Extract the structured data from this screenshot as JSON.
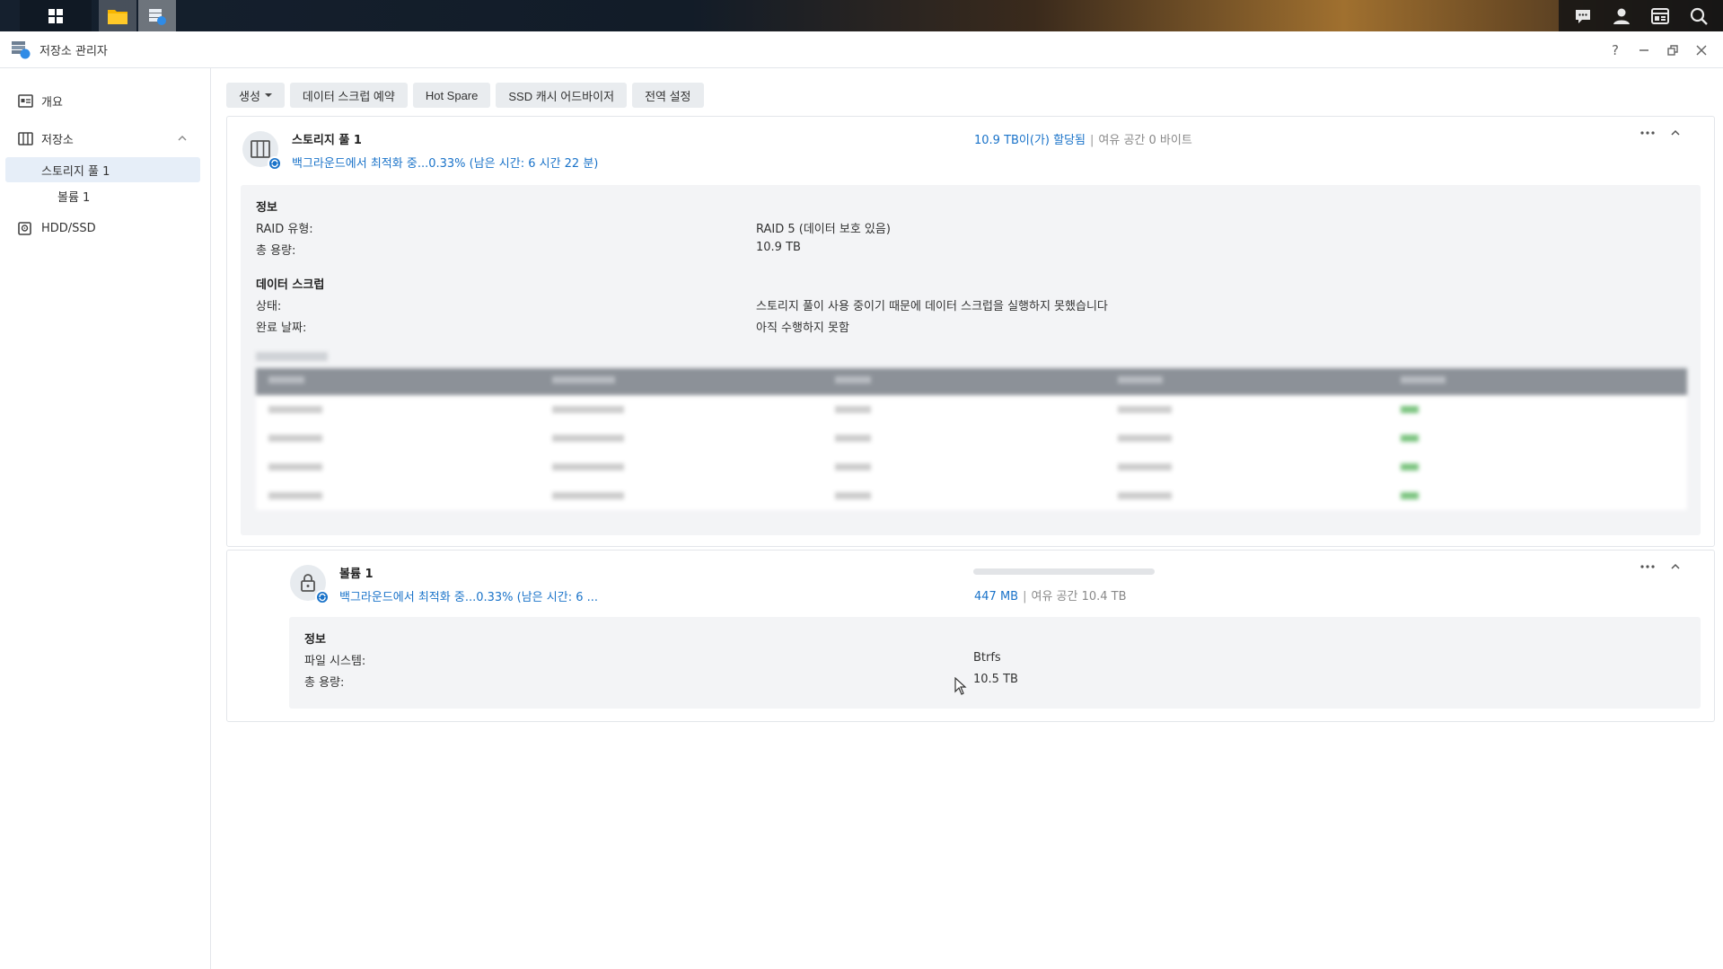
{
  "app": {
    "title": "저장소 관리자"
  },
  "window_controls": {
    "help": "?"
  },
  "sidebar": {
    "items": [
      {
        "label": "개요"
      },
      {
        "label": "저장소"
      },
      {
        "label": "HDD/SSD"
      }
    ],
    "sub_items": [
      {
        "label": "스토리지 풀 1"
      },
      {
        "label": "볼륨 1"
      }
    ]
  },
  "toolbar": {
    "create_label": "생성",
    "scrub_label": "데이터 스크럽 예약",
    "hotspare_label": "Hot Spare",
    "ssd_label": "SSD 캐시 어드바이저",
    "global_label": "전역 설정"
  },
  "pool": {
    "title": "스토리지 풀 1",
    "status": "백그라운드에서 최적화 중...0.33% (남은 시간: 6 시간 22 분)",
    "allocated": "10.9 TB이(가) 할당됨",
    "separator": "|",
    "free": "여유 공간 0 바이트",
    "info": {
      "heading": "정보",
      "raid_key": "RAID 유형:",
      "raid_val": "RAID 5 (데이터 보호 있음)",
      "cap_key": "총 용량:",
      "cap_val": "10.9 TB"
    },
    "scrub": {
      "heading": "데이터 스크럽",
      "status_key": "상태:",
      "status_val": "스토리지 풀이 사용 중이기 때문에 데이터 스크럽을 실행하지 못했습니다",
      "date_key": "완료 날짜:",
      "date_val": "아직 수행하지 못함"
    }
  },
  "volume": {
    "title": "볼륨 1",
    "status": "백그라운드에서 최적화 중...0.33% (남은 시간: 6 ...",
    "used": "447 MB",
    "separator": "|",
    "free": "여유 공간 10.4 TB",
    "usage_fraction": 4e-05,
    "info": {
      "heading": "정보",
      "fs_key": "파일 시스템:",
      "fs_val": "Btrfs",
      "cap_key": "총 용량:",
      "cap_val": "10.5 TB"
    }
  },
  "colors": {
    "accent": "#1a73c9",
    "panel": "#f3f4f6"
  }
}
